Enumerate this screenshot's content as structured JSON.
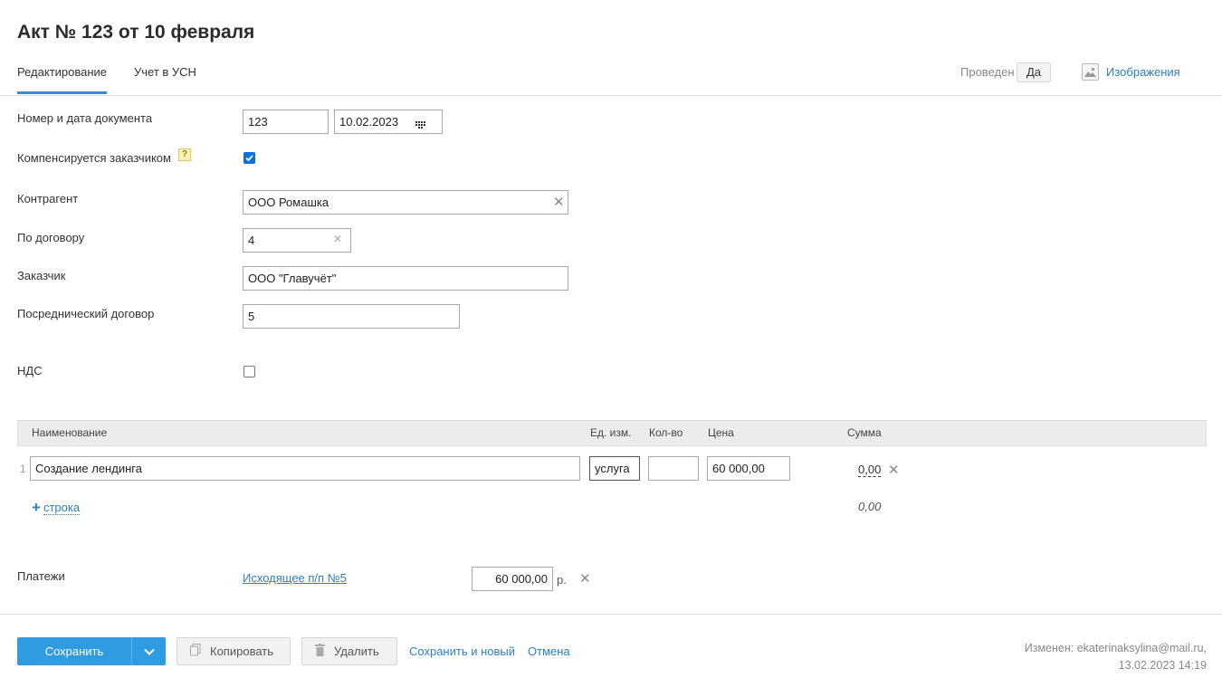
{
  "header": {
    "title": "Акт № 123 от 10 февраля",
    "tabs": [
      {
        "label": "Редактирование",
        "active": true
      },
      {
        "label": "Учет в УСН",
        "active": false
      }
    ],
    "posted_label": "Проведен",
    "posted_value": "Да",
    "images_label": "Изображения"
  },
  "form": {
    "doc_label": "Номер и дата документа",
    "doc_number": "123",
    "doc_date": "10.02.2023",
    "compensated_label": "Компенсируется заказчиком",
    "compensated_checked": true,
    "help_glyph": "?",
    "counterparty_label": "Контрагент",
    "counterparty_value": "ООО Ромашка",
    "contract_label": "По договору",
    "contract_value": "4",
    "customer_label": "Заказчик",
    "customer_value": "ООО \"Главучёт\"",
    "agency_label": "Посреднический договор",
    "agency_value": "5",
    "vat_label": "НДС",
    "vat_checked": false
  },
  "table": {
    "headers": {
      "name": "Наименование",
      "unit": "Ед. изм.",
      "qty": "Кол-во",
      "price": "Цена",
      "sum": "Сумма"
    },
    "rows": [
      {
        "num": "1",
        "name": "Создание лендинга",
        "unit": "услуга",
        "qty": "",
        "price": "60 000,00",
        "sum": "0,00"
      }
    ],
    "add_row_plus": "+",
    "add_row_label": "строка",
    "total": "0,00"
  },
  "payments": {
    "label": "Платежи",
    "link": "Исходящее п/п №5",
    "amount": "60 000,00",
    "currency": "р."
  },
  "footer": {
    "save": "Сохранить",
    "copy": "Копировать",
    "delete": "Удалить",
    "save_new": "Сохранить и новый",
    "cancel": "Отмена",
    "modified_line1": "Изменен: ekaterinaksylina@mail.ru,",
    "modified_line2": "13.02.2023 14:19"
  },
  "colors": {
    "accent": "#2f9be0",
    "link": "#2c7fc2",
    "checkbox": "#0a6fe0"
  },
  "icons": [
    "image-icon",
    "calendar-icon",
    "help-icon",
    "close-icon",
    "plus-icon",
    "chevron-down-icon",
    "copy-icon",
    "trash-icon"
  ]
}
